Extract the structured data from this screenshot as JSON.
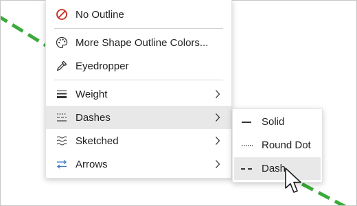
{
  "menu": {
    "items": [
      {
        "label": "No Outline",
        "icon": "no-outline-icon"
      },
      {
        "label": "More Shape Outline Colors...",
        "icon": "palette-icon"
      },
      {
        "label": "Eyedropper",
        "icon": "eyedropper-icon"
      },
      {
        "label": "Weight",
        "icon": "weight-lines-icon",
        "has_submenu": true
      },
      {
        "label": "Dashes",
        "icon": "dashes-icon",
        "has_submenu": true,
        "active": true
      },
      {
        "label": "Sketched",
        "icon": "sketched-icon",
        "has_submenu": true
      },
      {
        "label": "Arrows",
        "icon": "arrows-icon",
        "has_submenu": true
      }
    ]
  },
  "submenu": {
    "items": [
      {
        "label": "Solid",
        "icon": "solid-line-icon"
      },
      {
        "label": "Round Dot",
        "icon": "round-dot-line-icon"
      },
      {
        "label": "Dash",
        "icon": "dash-line-icon",
        "hovered": true
      }
    ]
  },
  "canvas": {
    "shape_line_color": "#3aaa3a",
    "shape_line_style": "dash"
  },
  "colors": {
    "no_outline_red": "#c42b1c",
    "arrows_blue": "#3a78c8",
    "highlight": "#e8e8e8"
  }
}
